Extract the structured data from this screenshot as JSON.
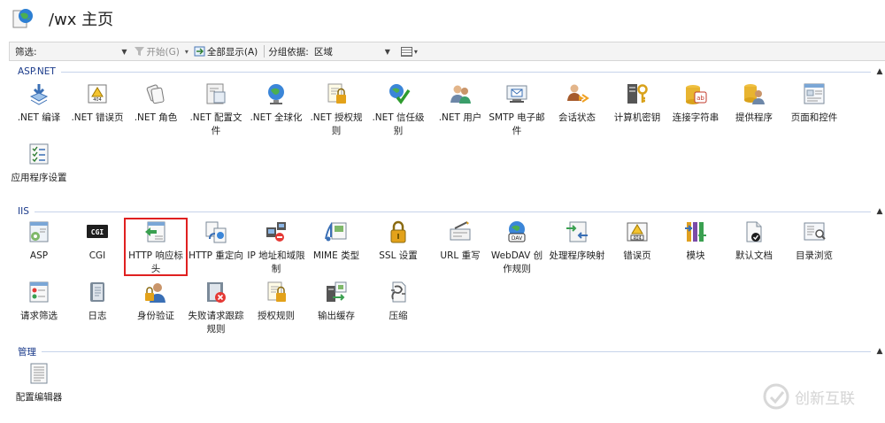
{
  "page": {
    "title": "/wx 主页"
  },
  "toolbar": {
    "filter_label": "筛选:",
    "start_label": "开始(G)",
    "show_all_label": "全部显示(A)",
    "group_by_label": "分组依据:",
    "group_by_value": "区域"
  },
  "groups": [
    {
      "label": "ASP.NET",
      "items": [
        {
          "label": ".NET 编译",
          "icon": "net-compile-icon"
        },
        {
          "label": ".NET 错误页",
          "icon": "net-error-pages-icon"
        },
        {
          "label": ".NET 角色",
          "icon": "net-roles-icon"
        },
        {
          "label": ".NET 配置文件",
          "icon": "net-profile-icon"
        },
        {
          "label": ".NET 全球化",
          "icon": "net-globalization-icon"
        },
        {
          "label": ".NET 授权规则",
          "icon": "net-authorization-icon"
        },
        {
          "label": ".NET 信任级别",
          "icon": "net-trust-levels-icon"
        },
        {
          "label": ".NET 用户",
          "icon": "net-users-icon"
        },
        {
          "label": "SMTP 电子邮件",
          "icon": "smtp-email-icon"
        },
        {
          "label": "会话状态",
          "icon": "session-state-icon"
        },
        {
          "label": "计算机密钥",
          "icon": "machine-key-icon"
        },
        {
          "label": "连接字符串",
          "icon": "connection-strings-icon"
        },
        {
          "label": "提供程序",
          "icon": "providers-icon"
        },
        {
          "label": "页面和控件",
          "icon": "pages-controls-icon"
        },
        {
          "label": "应用程序设置",
          "icon": "app-settings-icon"
        }
      ]
    },
    {
      "label": "IIS",
      "items": [
        {
          "label": "ASP",
          "icon": "asp-icon"
        },
        {
          "label": "CGI",
          "icon": "cgi-icon"
        },
        {
          "label": "HTTP 响应标头",
          "icon": "http-response-headers-icon",
          "selected": true
        },
        {
          "label": "HTTP 重定向",
          "icon": "http-redirect-icon"
        },
        {
          "label": "IP 地址和域限制",
          "icon": "ip-domain-restrictions-icon"
        },
        {
          "label": "MIME 类型",
          "icon": "mime-types-icon"
        },
        {
          "label": "SSL 设置",
          "icon": "ssl-settings-icon"
        },
        {
          "label": "URL 重写",
          "icon": "url-rewrite-icon"
        },
        {
          "label": "WebDAV 创作规则",
          "icon": "webdav-icon"
        },
        {
          "label": "处理程序映射",
          "icon": "handler-mappings-icon"
        },
        {
          "label": "错误页",
          "icon": "error-pages-icon"
        },
        {
          "label": "模块",
          "icon": "modules-icon"
        },
        {
          "label": "默认文档",
          "icon": "default-document-icon"
        },
        {
          "label": "目录浏览",
          "icon": "directory-browsing-icon"
        },
        {
          "label": "请求筛选",
          "icon": "request-filtering-icon"
        },
        {
          "label": "日志",
          "icon": "logging-icon"
        },
        {
          "label": "身份验证",
          "icon": "authentication-icon"
        },
        {
          "label": "失败请求跟踪规则",
          "icon": "failed-request-tracing-icon"
        },
        {
          "label": "授权规则",
          "icon": "authorization-rules-icon"
        },
        {
          "label": "输出缓存",
          "icon": "output-caching-icon"
        },
        {
          "label": "压缩",
          "icon": "compression-icon"
        }
      ]
    },
    {
      "label": "管理",
      "items": [
        {
          "label": "配置编辑器",
          "icon": "configuration-editor-icon"
        }
      ]
    }
  ],
  "watermark": {
    "text": "创新互联"
  }
}
